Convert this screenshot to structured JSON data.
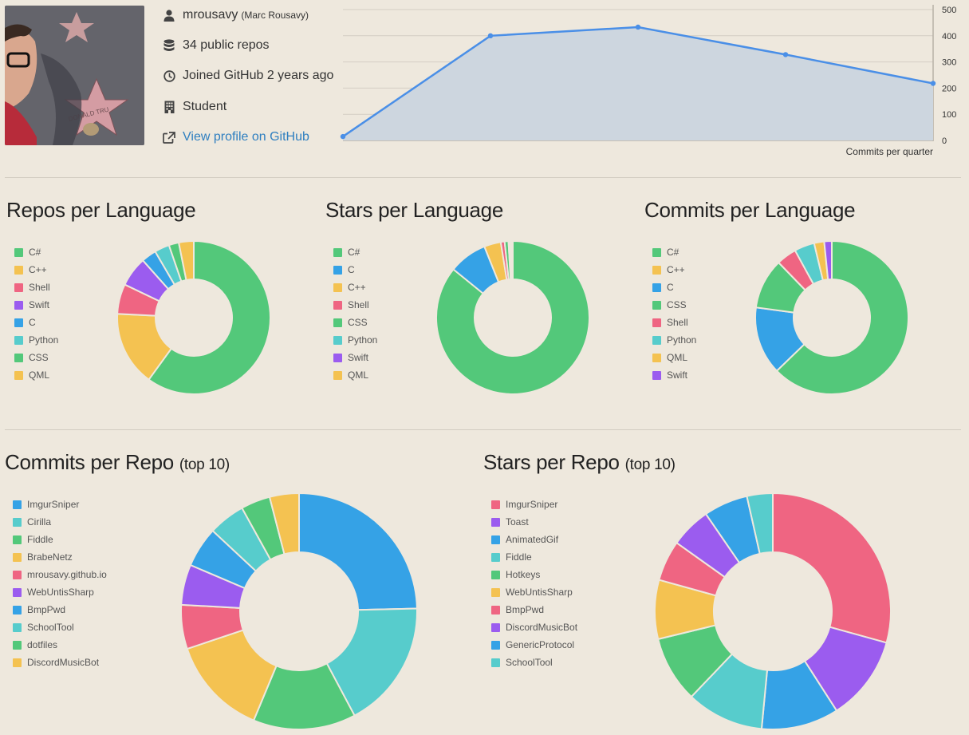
{
  "profile": {
    "username": "mrousavy",
    "full_name": "(Marc Rousavy)",
    "repos": "34 public repos",
    "joined": "Joined GitHub 2 years ago",
    "occupation": "Student",
    "profile_link": "View profile on GitHub",
    "avatar_star_text": "DONALD TRU"
  },
  "colors": {
    "green": "#53c87a",
    "yellow": "#f4c251",
    "pink": "#ef6582",
    "purple": "#9b5cef",
    "blue": "#35a2e6",
    "teal": "#57cccc",
    "line": "#4a8fe7",
    "area": "#cdd6df"
  },
  "chart_data": [
    {
      "type": "area",
      "title": "",
      "xlabel": "Commits per quarter",
      "ylabel": "",
      "ylim": [
        0,
        500
      ],
      "y_ticks": [
        "0",
        "100",
        "200",
        "300",
        "400",
        "500"
      ],
      "series": [
        {
          "values": [
            15,
            400,
            433,
            328,
            218
          ]
        }
      ],
      "grid": true,
      "y_axis_position": "right"
    },
    {
      "type": "pie",
      "title": "Repos per Language",
      "legend": [
        "C#",
        "C++",
        "Shell",
        "Swift",
        "C",
        "Python",
        "CSS",
        "QML"
      ],
      "values": [
        57,
        15,
        6,
        6,
        3,
        3,
        2,
        3
      ],
      "colors": [
        "#53c87a",
        "#f4c251",
        "#ef6582",
        "#9b5cef",
        "#35a2e6",
        "#57cccc",
        "#53c87a",
        "#f4c251"
      ],
      "legend_placement": "left"
    },
    {
      "type": "pie",
      "title": "Stars per Language",
      "legend": [
        "C#",
        "C",
        "C++",
        "Shell",
        "CSS",
        "Python",
        "Swift",
        "QML"
      ],
      "values": [
        85,
        8,
        3.5,
        0.8,
        0.8,
        0.3,
        0.3,
        0.3
      ],
      "colors": [
        "#53c87a",
        "#35a2e6",
        "#f4c251",
        "#ef6582",
        "#53c87a",
        "#57cccc",
        "#9b5cef",
        "#f4c251"
      ],
      "legend_placement": "left"
    },
    {
      "type": "pie",
      "title": "Commits per Language",
      "legend": [
        "C#",
        "C++",
        "C",
        "CSS",
        "Shell",
        "Python",
        "QML",
        "Swift"
      ],
      "values": [
        59,
        0,
        13.5,
        10,
        4,
        4,
        2,
        1.5
      ],
      "colors": [
        "#53c87a",
        "#f4c251",
        "#35a2e6",
        "#53c87a",
        "#ef6582",
        "#57cccc",
        "#f4c251",
        "#9b5cef"
      ],
      "legend_placement": "left"
    },
    {
      "type": "pie",
      "title": "Commits per Repo",
      "title_suffix": "(top 10)",
      "legend": [
        "ImgurSniper",
        "Cirilla",
        "Fiddle",
        "BrabeNetz",
        "mrousavy.github.io",
        "WebUntisSharp",
        "BmpPwd",
        "SchoolTool",
        "dotfiles",
        "DiscordMusicBot"
      ],
      "values": [
        24.5,
        17.5,
        14,
        13.5,
        6,
        5.5,
        5.5,
        5,
        4,
        4
      ],
      "colors": [
        "#35a2e6",
        "#57cccc",
        "#53c87a",
        "#f4c251",
        "#ef6582",
        "#9b5cef",
        "#35a2e6",
        "#57cccc",
        "#53c87a",
        "#f4c251"
      ],
      "legend_placement": "left"
    },
    {
      "type": "pie",
      "title": "Stars per Repo",
      "title_suffix": "(top 10)",
      "legend": [
        "ImgurSniper",
        "Toast",
        "AnimatedGif",
        "Fiddle",
        "Hotkeys",
        "WebUntisSharp",
        "BmpPwd",
        "DiscordMusicBot",
        "GenericProtocol",
        "SchoolTool"
      ],
      "values": [
        29,
        11.5,
        10.5,
        10.5,
        9,
        8,
        5.5,
        5.5,
        6,
        3.5
      ],
      "colors": [
        "#ef6582",
        "#9b5cef",
        "#35a2e6",
        "#57cccc",
        "#53c87a",
        "#f4c251",
        "#ef6582",
        "#9b5cef",
        "#35a2e6",
        "#57cccc"
      ],
      "legend_placement": "left"
    }
  ]
}
